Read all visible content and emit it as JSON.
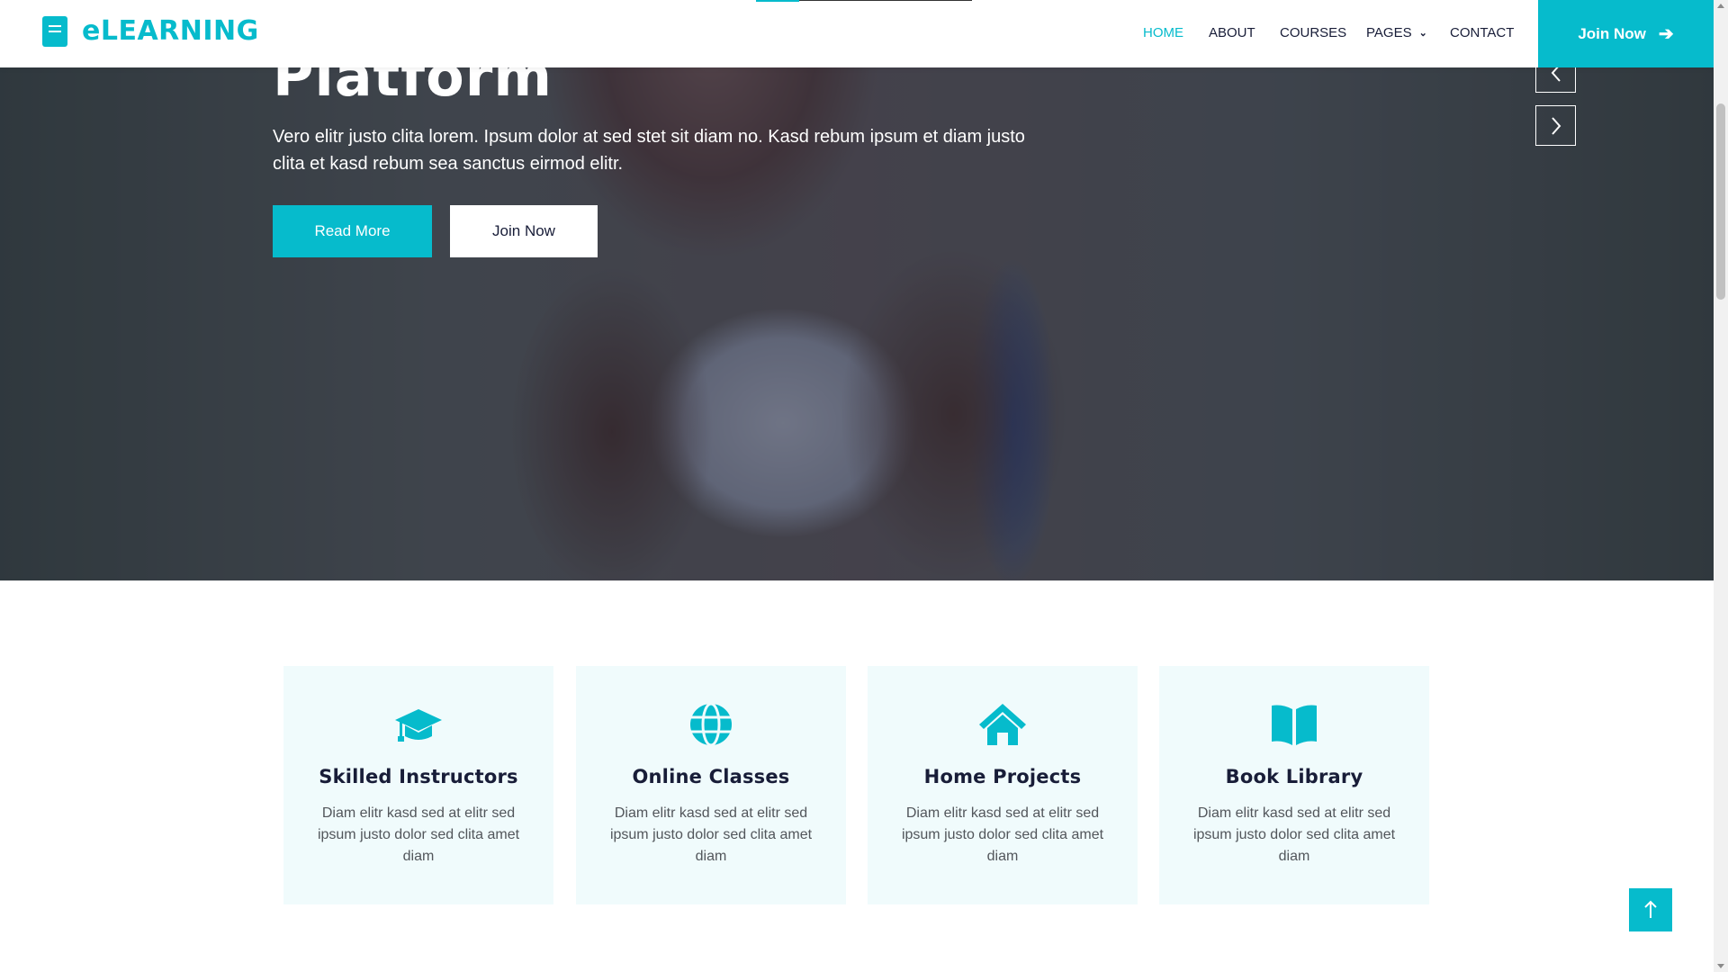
{
  "brand": {
    "name": "eLEARNING",
    "icon": "book-icon",
    "accent_color": "#06bbcc"
  },
  "nav": {
    "items": [
      {
        "label": "HOME",
        "active": true
      },
      {
        "label": "ABOUT"
      },
      {
        "label": "COURSES"
      },
      {
        "label": "PAGES",
        "dropdown": true
      },
      {
        "label": "CONTACT"
      }
    ],
    "cta_label": "Join Now",
    "cta_icon": "arrow-right-icon"
  },
  "hero": {
    "title": "Platform",
    "text": "Vero elitr justo clita lorem. Ipsum dolor at sed stet sit diam no. Kasd rebum ipsum et diam justo clita et kasd rebum sea sanctus eirmod elitr.",
    "primary_button": "Read More",
    "secondary_button": "Join Now",
    "prev_icon": "chevron-left-icon",
    "next_icon": "chevron-right-icon"
  },
  "services": [
    {
      "title": "Skilled Instructors",
      "text": "Diam elitr kasd sed at elitr sed ipsum justo dolor sed clita amet diam",
      "icon": "graduation-cap-icon"
    },
    {
      "title": "Online Classes",
      "text": "Diam elitr kasd sed at elitr sed ipsum justo dolor sed clita amet diam",
      "icon": "globe-icon"
    },
    {
      "title": "Home Projects",
      "text": "Diam elitr kasd sed at elitr sed ipsum justo dolor sed clita amet diam",
      "icon": "home-icon"
    },
    {
      "title": "Book Library",
      "text": "Diam elitr kasd sed at elitr sed ipsum justo dolor sed clita amet diam",
      "icon": "book-open-icon"
    }
  ],
  "back_to_top_icon": "arrow-up-icon"
}
